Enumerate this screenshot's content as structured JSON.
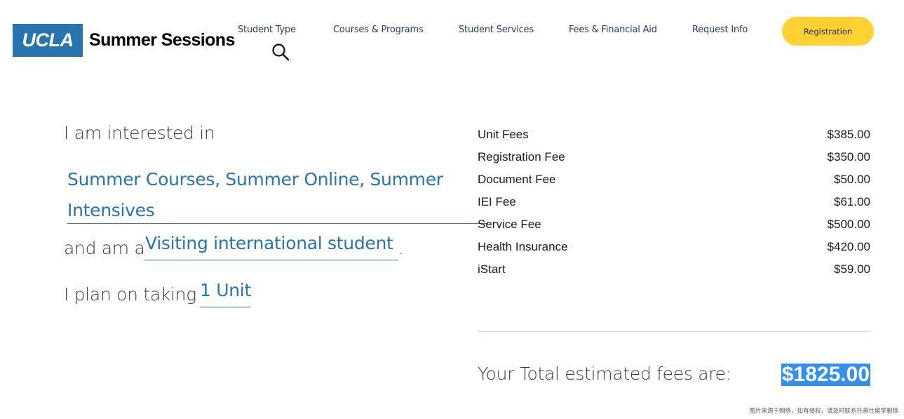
{
  "header": {
    "logo_mark": "UCLA",
    "logo_text": "Summer Sessions",
    "nav": [
      {
        "label": "Student Type"
      },
      {
        "label": "Courses & Programs"
      },
      {
        "label": "Student Services"
      },
      {
        "label": "Fees & Financial Aid"
      },
      {
        "label": "Request Info"
      }
    ],
    "search_icon": "search-icon",
    "registration_label": "Registration",
    "colors": {
      "brand_blue": "#2774ae",
      "button_gold": "#ffd232"
    }
  },
  "estimator": {
    "phrase_1": "I am interested in",
    "program_value": "Summer Courses, Summer Online, Summer Intensives",
    "phrase_2": "and am a",
    "student_type_value": "Visiting international student",
    "phrase_2_end": ".",
    "phrase_3": "I plan on taking",
    "units_value": "1 Unit"
  },
  "fees": {
    "rows": [
      {
        "label": "Unit Fees",
        "amount": "$385.00"
      },
      {
        "label": "Registration Fee",
        "amount": "$350.00"
      },
      {
        "label": "Document Fee",
        "amount": "$50.00"
      },
      {
        "label": "IEI Fee",
        "amount": "$61.00"
      },
      {
        "label": "Service Fee",
        "amount": "$500.00"
      },
      {
        "label": "Health Insurance",
        "amount": "$420.00"
      },
      {
        "label": "iStart",
        "amount": "$59.00"
      }
    ],
    "total_label": "Your Total estimated fees are:",
    "total_value": "$1825.00",
    "highlight_color": "#3390f0"
  },
  "watermark": "图片来源于网络，如有侵权，请及时联系托普仕留学删除"
}
